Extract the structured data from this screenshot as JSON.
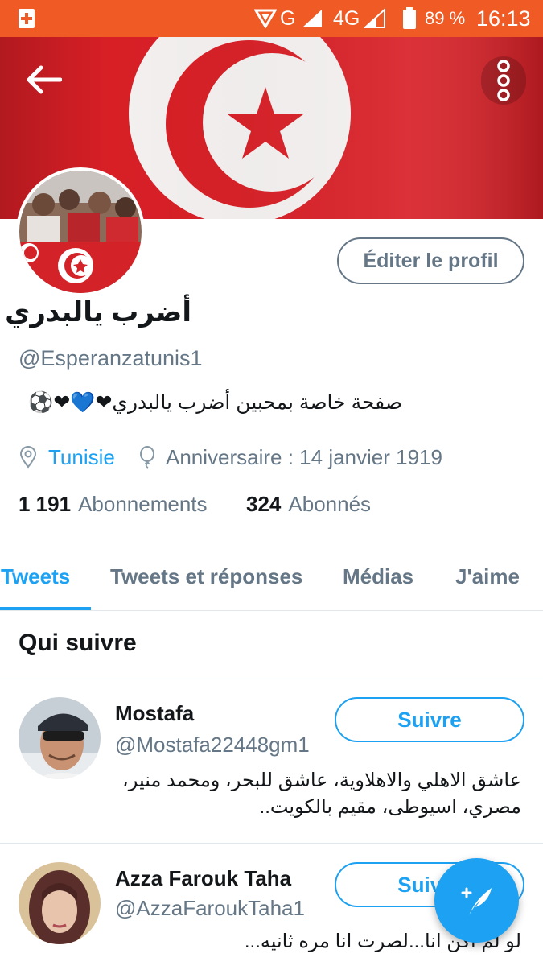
{
  "statusbar": {
    "left_icon": "medical-cross-icon",
    "network_g": "G",
    "network_4g": "4G",
    "battery": "89 %",
    "time": "16:13"
  },
  "header": {
    "back_icon": "arrow-left-icon",
    "menu_icon": "more-vertical-icon"
  },
  "profile": {
    "edit_label": "Éditer le profil",
    "name": "أضرب يالبدري",
    "handle": "@Esperanzatunis1",
    "bio": "صفحة خاصة بمحبين أضرب يالبدري❤💙❤⚽",
    "location": "Tunisie",
    "birthday": "Anniversaire : 14 janvier 1919",
    "following_count": "1 191",
    "following_label": "Abonnements",
    "followers_count": "324",
    "followers_label": "Abonnés"
  },
  "tabs": [
    {
      "label": "Tweets",
      "active": true
    },
    {
      "label": "Tweets et réponses",
      "active": false
    },
    {
      "label": "Médias",
      "active": false
    },
    {
      "label": "J'aime",
      "active": false
    }
  ],
  "who_to_follow": {
    "title": "Qui suivre",
    "users": [
      {
        "name": "Mostafa",
        "handle": "@Mostafa22448gm1",
        "bio": "عاشق الاهلي والاهلاوية، عاشق للبحر، ومحمد منير، مصري، اسيوطى، مقيم بالكويت..",
        "button": "Suivre"
      },
      {
        "name": "Azza Farouk Taha",
        "handle": "@AzzaFaroukTaha1",
        "bio": "لو لم اكن انا...لصرت انا مره ثانيه...",
        "button": "Suivre"
      }
    ]
  },
  "fab": {
    "icon": "compose-tweet-icon"
  },
  "colors": {
    "statusbar": "#f05a24",
    "accent": "#1da1f2",
    "secondary_text": "#657786",
    "flag_red": "#d81f26"
  }
}
